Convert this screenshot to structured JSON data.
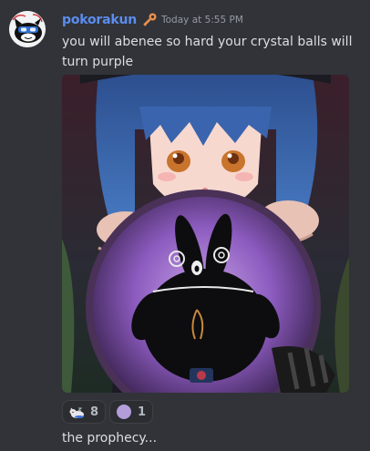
{
  "message": {
    "username": "pokorakun",
    "timestamp": "Today at 5:55 PM",
    "text": "you will abenee so hard your crystal balls will turn purple",
    "followup_text": "the prophecy..."
  },
  "reactions": [
    {
      "emoji": "sleeping-cat-emoji",
      "count": "8"
    },
    {
      "emoji": "purple-circle-emoji",
      "count": "1"
    }
  ],
  "colors": {
    "background": "#313338",
    "username": "#5b8df0",
    "timestamp": "#949ba4",
    "text": "#dbdee1",
    "purple_circle": "#b39ddb"
  },
  "icons": {
    "role": "key-icon",
    "avatar": "avatar-image"
  }
}
